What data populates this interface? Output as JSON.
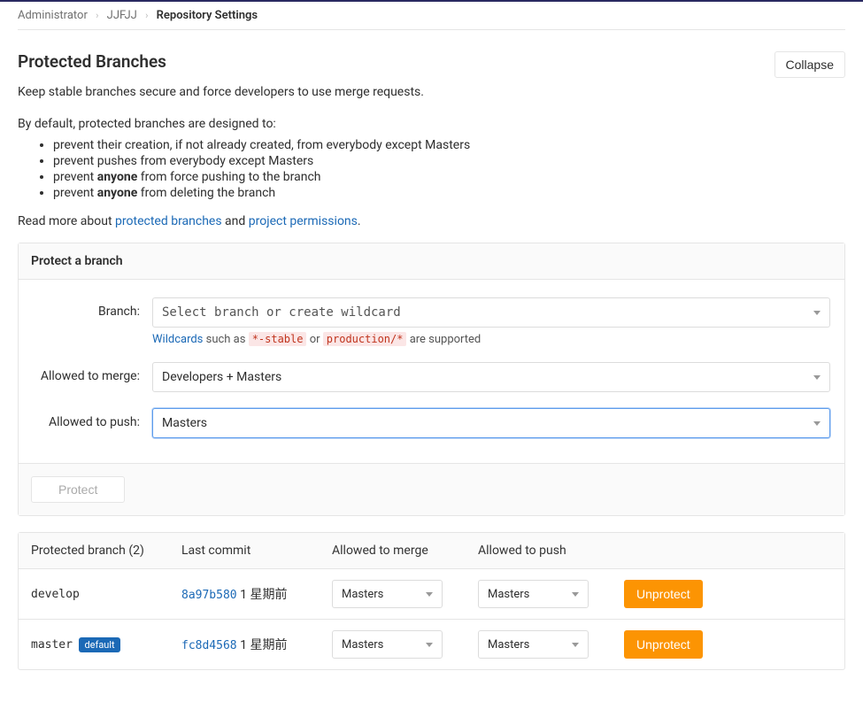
{
  "breadcrumb": {
    "items": [
      "Administrator",
      "JJFJJ"
    ],
    "current": "Repository Settings"
  },
  "section": {
    "title": "Protected Branches",
    "collapse": "Collapse",
    "lead": "Keep stable branches secure and force developers to use merge requests.",
    "designIntro": "By default, protected branches are designed to:",
    "rules": {
      "r1": "prevent their creation, if not already created, from everybody except Masters",
      "r2": "prevent pushes from everybody except Masters",
      "r3a": "prevent ",
      "r3b": "anyone",
      "r3c": " from force pushing to the branch",
      "r4a": "prevent ",
      "r4b": "anyone",
      "r4c": " from deleting the branch"
    },
    "readMore": {
      "prefix": "Read more about ",
      "link1": "protected branches",
      "mid": " and ",
      "link2": "project permissions",
      "suffix": "."
    }
  },
  "form": {
    "panelTitle": "Protect a branch",
    "branchLabel": "Branch:",
    "branchPlaceholder": "Select branch or create wildcard",
    "wildcardsLink": "Wildcards",
    "wildcardsText1": " such as ",
    "wildcardsCode1": "*-stable",
    "wildcardsText2": " or ",
    "wildcardsCode2": "production/*",
    "wildcardsText3": " are supported",
    "mergeLabel": "Allowed to merge:",
    "mergeValue": "Developers + Masters",
    "pushLabel": "Allowed to push:",
    "pushValue": "Masters",
    "protectBtn": "Protect"
  },
  "table": {
    "headers": {
      "branch": "Protected branch (2)",
      "commit": "Last commit",
      "merge": "Allowed to merge",
      "push": "Allowed to push"
    },
    "rows": [
      {
        "branch": "develop",
        "default": false,
        "hash": "8a97b580",
        "time": "1 星期前",
        "merge": "Masters",
        "push": "Masters",
        "action": "Unprotect"
      },
      {
        "branch": "master",
        "default": true,
        "defaultLabel": "default",
        "hash": "fc8d4568",
        "time": "1 星期前",
        "merge": "Masters",
        "push": "Masters",
        "action": "Unprotect"
      }
    ]
  }
}
